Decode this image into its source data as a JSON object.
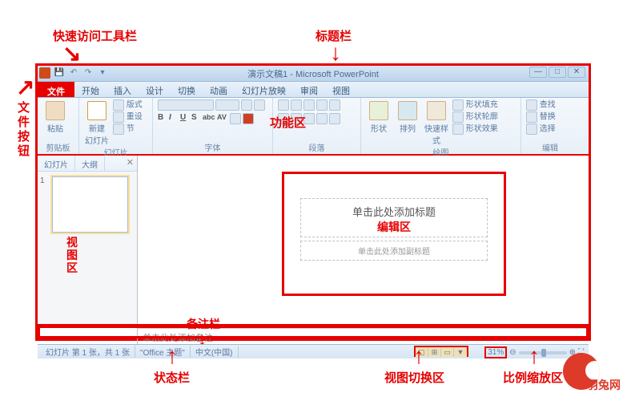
{
  "annotations": {
    "quick_access": "快速访问工具栏",
    "title_bar": "标题栏",
    "file_button_v": "文\n件\n按\n钮",
    "ribbon_area": "功能区",
    "thumb_area": "视\n图\n区",
    "edit_area": "编辑区",
    "notes_bar": "备注栏",
    "status_bar": "状态栏",
    "view_switch": "视图切换区",
    "zoom_area": "比例缩放区"
  },
  "titlebar": {
    "doc_title": "演示文稿1 - Microsoft PowerPoint"
  },
  "tabs": {
    "file": "文件",
    "items": [
      "开始",
      "插入",
      "设计",
      "切换",
      "动画",
      "幻灯片放映",
      "审阅",
      "视图"
    ]
  },
  "ribbon_groups": {
    "clipboard": {
      "label": "剪贴板",
      "big": "粘贴"
    },
    "slides": {
      "label": "幻灯片",
      "big": "新建\n幻灯片",
      "opts": [
        "版式",
        "重设",
        "节"
      ]
    },
    "font": {
      "label": "字体"
    },
    "paragraph": {
      "label": "段落"
    },
    "drawing": {
      "label": "绘图",
      "btns": [
        "形状",
        "排列",
        "快速样式"
      ],
      "opts": [
        "形状填充",
        "形状轮廓",
        "形状效果"
      ]
    },
    "editing": {
      "label": "编辑",
      "opts": [
        "查找",
        "替换",
        "选择"
      ]
    }
  },
  "thumb": {
    "tab1": "幻灯片",
    "tab2": "大纲",
    "num": "1"
  },
  "slide": {
    "title_ph": "单击此处添加标题",
    "sub_ph": "单击此处添加副标题"
  },
  "notes": {
    "placeholder": "单击此处添加备注"
  },
  "status": {
    "slidepos": "幻灯片 第 1 张，共 1 张",
    "theme": "\"Office 主题\"",
    "lang": "中文(中国)",
    "zoom": "31%"
  },
  "watermark": "羽兔网"
}
